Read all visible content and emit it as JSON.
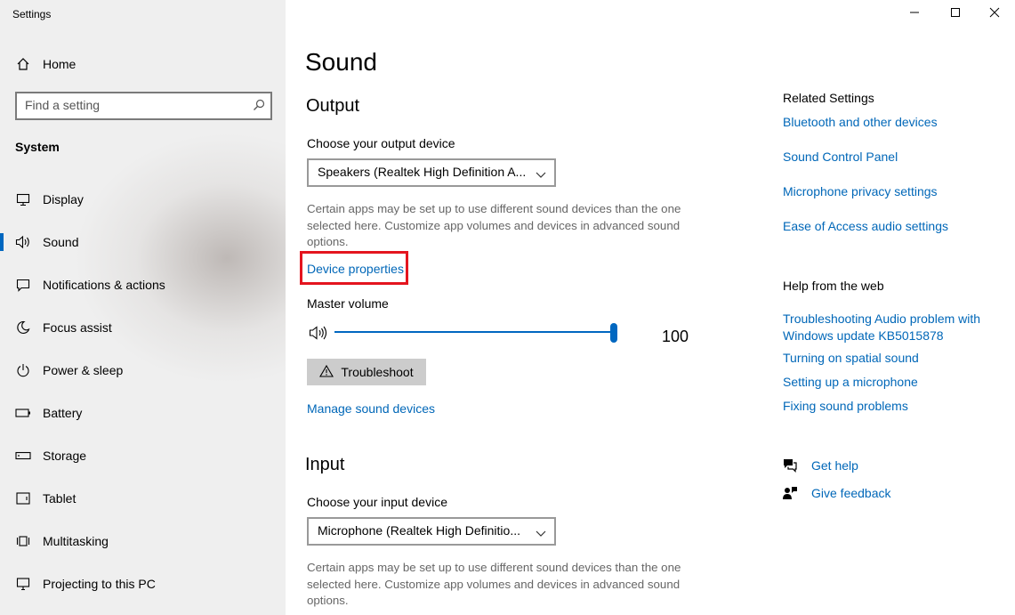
{
  "window": {
    "title": "Settings",
    "controls": {
      "minimize": "minimize-icon",
      "maximize": "maximize-icon",
      "close": "close-icon"
    }
  },
  "sidebar": {
    "home": "Home",
    "search_placeholder": "Find a setting",
    "section": "System",
    "items": [
      {
        "label": "Display",
        "icon": "display-icon"
      },
      {
        "label": "Sound",
        "icon": "speaker-icon",
        "active": true
      },
      {
        "label": "Notifications & actions",
        "icon": "notifications-icon"
      },
      {
        "label": "Focus assist",
        "icon": "moon-icon"
      },
      {
        "label": "Power & sleep",
        "icon": "power-icon"
      },
      {
        "label": "Battery",
        "icon": "battery-icon"
      },
      {
        "label": "Storage",
        "icon": "storage-icon"
      },
      {
        "label": "Tablet",
        "icon": "tablet-icon"
      },
      {
        "label": "Multitasking",
        "icon": "multitasking-icon"
      },
      {
        "label": "Projecting to this PC",
        "icon": "projecting-icon"
      }
    ]
  },
  "main": {
    "title": "Sound",
    "output": {
      "heading": "Output",
      "device_label": "Choose your output device",
      "device_value": "Speakers (Realtek High Definition A...",
      "description": "Certain apps may be set up to use different sound devices than the one selected here. Customize app volumes and devices in advanced sound options.",
      "device_properties": "Device properties",
      "volume_label": "Master volume",
      "volume_value": "100",
      "volume_fraction": 1.0,
      "troubleshoot": "Troubleshoot",
      "manage": "Manage sound devices"
    },
    "input": {
      "heading": "Input",
      "device_label": "Choose your input device",
      "device_value": "Microphone (Realtek High Definitio...",
      "description": "Certain apps may be set up to use different sound devices than the one selected here. Customize app volumes and devices in advanced sound options."
    }
  },
  "related": {
    "title": "Related Settings",
    "links": [
      "Bluetooth and other devices",
      "Sound Control Panel",
      "Microphone privacy settings",
      "Ease of Access audio settings"
    ]
  },
  "help": {
    "title": "Help from the web",
    "links": [
      "Troubleshooting Audio problem with Windows update KB5015878",
      "Turning on spatial sound",
      "Setting up a microphone",
      "Fixing sound problems"
    ]
  },
  "support": {
    "get_help": "Get help",
    "give_feedback": "Give feedback"
  },
  "colors": {
    "accent": "#0067c0",
    "link": "#0067b8",
    "highlight": "#e4151f"
  }
}
